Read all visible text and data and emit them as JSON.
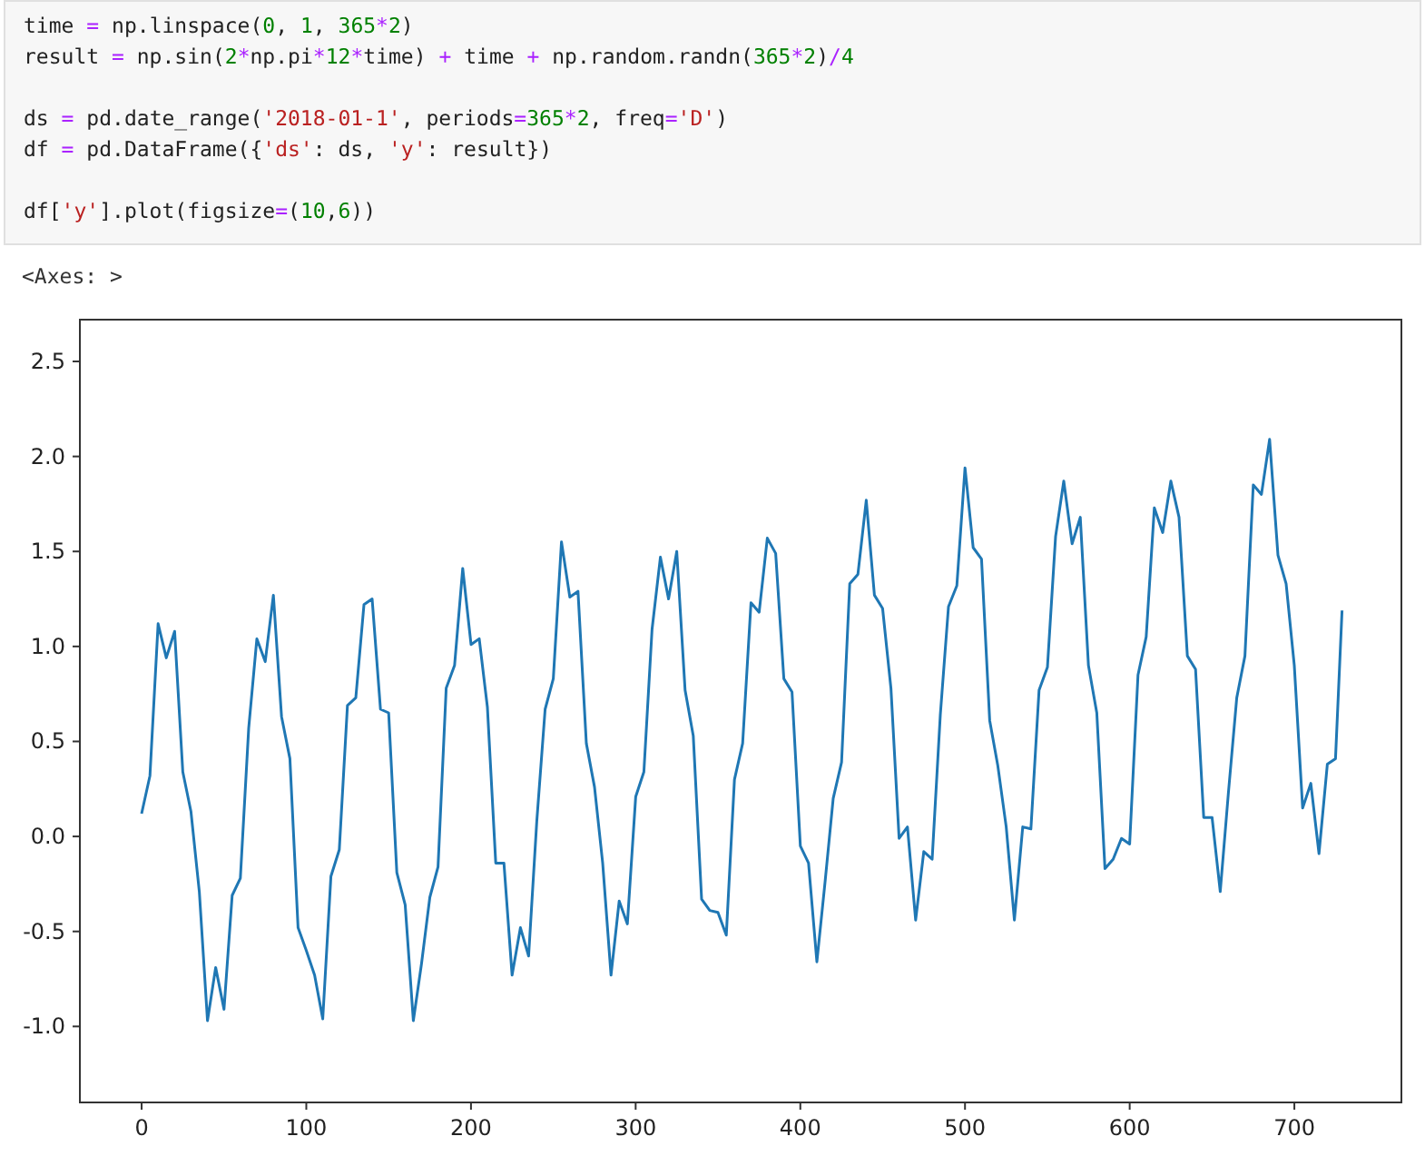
{
  "code_cell": {
    "paragraphs": [
      [
        "time = np.linspace(0, 1, 365*2)",
        "result = np.sin(2*np.pi*12*time) + time + np.random.randn(365*2)/4"
      ],
      [
        "ds = pd.date_range('2018-01-1', periods=365*2, freq='D')",
        "df = pd.DataFrame({'ds': ds, 'y': result})"
      ],
      [
        "df['y'].plot(figsize=(10,6))"
      ]
    ]
  },
  "output": {
    "text": "<Axes: >",
    "chart_data": {
      "type": "line",
      "xlim": [
        -37.5,
        765
      ],
      "ylim": [
        -1.4,
        2.72
      ],
      "xticks": [
        0,
        100,
        200,
        300,
        400,
        500,
        600,
        700
      ],
      "yticks": [
        {
          "value": -1.0,
          "label": "-1.0"
        },
        {
          "value": -0.5,
          "label": "-0.5"
        },
        {
          "value": 0,
          "label": "0.0"
        },
        {
          "value": 0.5,
          "label": "0.5"
        },
        {
          "value": 1.0,
          "label": "1.0"
        },
        {
          "value": 1.5,
          "label": "1.5"
        },
        {
          "value": 2.0,
          "label": "2.0"
        },
        {
          "value": 2.5,
          "label": "2.5"
        }
      ],
      "x": [
        0,
        5,
        10,
        15,
        20,
        25,
        30,
        35,
        40,
        45,
        50,
        55,
        60,
        65,
        70,
        75,
        80,
        85,
        90,
        95,
        100,
        105,
        110,
        115,
        120,
        125,
        130,
        135,
        140,
        145,
        150,
        155,
        160,
        165,
        170,
        175,
        180,
        185,
        190,
        195,
        200,
        205,
        210,
        215,
        220,
        225,
        230,
        235,
        240,
        245,
        250,
        255,
        260,
        265,
        270,
        275,
        280,
        285,
        290,
        295,
        300,
        305,
        310,
        315,
        320,
        325,
        330,
        335,
        340,
        345,
        350,
        355,
        360,
        365,
        370,
        375,
        380,
        385,
        390,
        395,
        400,
        405,
        410,
        415,
        420,
        425,
        430,
        435,
        440,
        445,
        450,
        455,
        460,
        465,
        470,
        475,
        480,
        485,
        490,
        495,
        500,
        505,
        510,
        515,
        520,
        525,
        530,
        535,
        540,
        545,
        550,
        555,
        560,
        565,
        570,
        575,
        580,
        585,
        590,
        595,
        600,
        605,
        610,
        615,
        620,
        625,
        630,
        635,
        640,
        645,
        650,
        655,
        660,
        665,
        670,
        675,
        680,
        685,
        690,
        695,
        700,
        705,
        710,
        715,
        720,
        725,
        729
      ],
      "series": [
        {
          "color": "#1f77b4",
          "values": [
            0.12,
            0.32,
            1.12,
            0.94,
            1.08,
            0.34,
            0.13,
            -0.29,
            -0.97,
            -0.69,
            -0.91,
            -0.31,
            -0.22,
            0.57,
            1.04,
            0.92,
            1.27,
            0.63,
            0.41,
            -0.48,
            -0.6,
            -0.73,
            -0.96,
            -0.21,
            -0.07,
            0.69,
            0.73,
            1.22,
            1.25,
            0.67,
            0.65,
            -0.19,
            -0.36,
            -0.97,
            -0.67,
            -0.32,
            -0.16,
            0.78,
            0.9,
            1.41,
            1.01,
            1.04,
            0.68,
            -0.14,
            -0.14,
            -0.73,
            -0.48,
            -0.63,
            0.08,
            0.67,
            0.83,
            1.55,
            1.26,
            1.29,
            0.49,
            0.26,
            -0.14,
            -0.73,
            -0.34,
            -0.46,
            0.21,
            0.34,
            1.09,
            1.47,
            1.25,
            1.5,
            0.77,
            0.53,
            -0.33,
            -0.39,
            -0.4,
            -0.52,
            0.3,
            0.49,
            1.23,
            1.18,
            1.57,
            1.49,
            0.83,
            0.76,
            -0.05,
            -0.14,
            -0.66,
            -0.24,
            0.2,
            0.39,
            1.33,
            1.38,
            1.77,
            1.27,
            1.2,
            0.78,
            -0.01,
            0.05,
            -0.44,
            -0.08,
            -0.12,
            0.64,
            1.21,
            1.32,
            1.94,
            1.52,
            1.46,
            0.61,
            0.37,
            0.05,
            -0.44,
            0.05,
            0.04,
            0.77,
            0.89,
            1.58,
            1.87,
            1.54,
            1.68,
            0.9,
            0.65,
            -0.17,
            -0.12,
            -0.01,
            -0.04,
            0.85,
            1.05,
            1.73,
            1.6,
            1.87,
            1.68,
            0.95,
            0.88,
            0.1,
            0.1,
            -0.29,
            0.23,
            0.73,
            0.95,
            1.85,
            1.8,
            2.09,
            1.48,
            1.33,
            0.9,
            0.15,
            0.28,
            -0.09,
            0.38,
            0.41,
            1.19
          ]
        }
      ]
    }
  }
}
